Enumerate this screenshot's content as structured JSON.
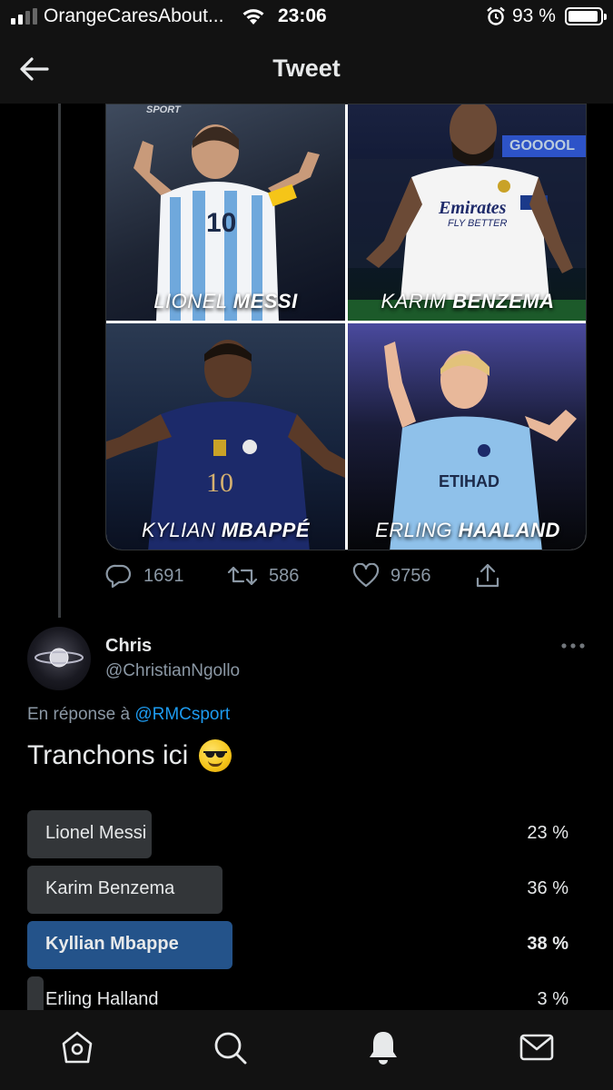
{
  "status_bar": {
    "carrier": "OrangeCaresAbout...",
    "time": "23:06",
    "battery": "93 %",
    "battery_level": 0.93
  },
  "header": {
    "title": "Tweet"
  },
  "media": {
    "tiles": [
      {
        "first": "LIONEL ",
        "last": "MESSI"
      },
      {
        "first": "KARIM ",
        "last": "BENZEMA"
      },
      {
        "first": "KYLIAN ",
        "last": "MBAPPÉ"
      },
      {
        "first": "ERLING ",
        "last": "HAALAND"
      }
    ],
    "watermark": "SPORT",
    "goal_text": "GOOOOL"
  },
  "actions": {
    "replies": "1691",
    "retweets": "586",
    "likes": "9756"
  },
  "reply": {
    "name": "Chris",
    "handle": "@ChristianNgollo",
    "reply_prefix": "En réponse à ",
    "reply_to": "@RMCsport",
    "text": "Tranchons ici"
  },
  "poll": {
    "options": [
      {
        "label": "Lionel Messi",
        "percent": "23 %",
        "value": 23,
        "winner": false
      },
      {
        "label": "Karim Benzema",
        "percent": "36 %",
        "value": 36,
        "winner": false
      },
      {
        "label": "Kyllian Mbappe",
        "percent": "38 %",
        "value": 38,
        "winner": true
      },
      {
        "label": "Erling Halland",
        "percent": "3 %",
        "value": 3,
        "winner": false
      }
    ]
  },
  "colors": {
    "accent": "#1d9bf0",
    "poll_winner": "#24538a",
    "poll_bar": "#333639"
  },
  "tabs": [
    "home-icon",
    "search-icon",
    "notifications-icon",
    "messages-icon"
  ]
}
